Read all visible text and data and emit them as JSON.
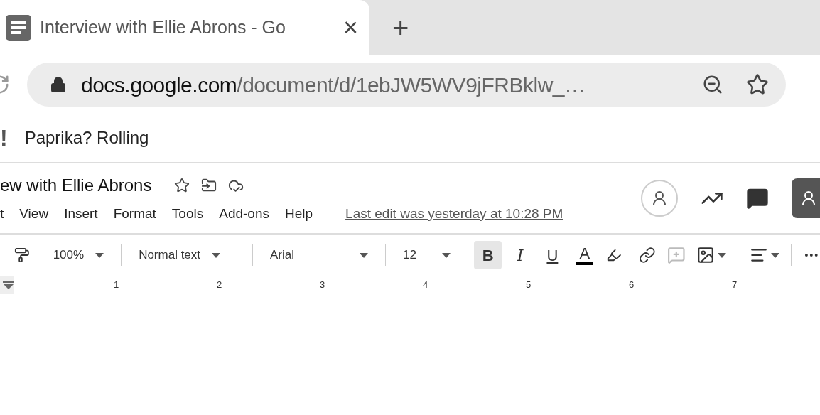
{
  "browser": {
    "tab": {
      "title": "Interview with Ellie Abrons - Go",
      "close": "×",
      "selected": true
    },
    "new_tab": "+",
    "address": {
      "host": "docs.google.com",
      "path": "/document/d/1ebJW5WV9jFRBklw_…"
    },
    "bookmarks": [
      {
        "icon": "!",
        "label": "Paprika? Rolling"
      }
    ]
  },
  "doc": {
    "title": "ew with Ellie Abrons",
    "menu": [
      {
        "label": "t"
      },
      {
        "label": "View"
      },
      {
        "label": "Insert"
      },
      {
        "label": "Format"
      },
      {
        "label": "Tools"
      },
      {
        "label": "Add-ons"
      },
      {
        "label": "Help"
      }
    ],
    "last_edit": "Last edit was yesterday at 10:28 PM"
  },
  "toolbar": {
    "zoom": "100%",
    "style": "Normal text",
    "font": "Arial",
    "size": "12",
    "buttons": [
      {
        "kind": "bold",
        "label": "B",
        "selected": true
      },
      {
        "kind": "italic",
        "label": "I",
        "selected": false
      },
      {
        "kind": "underline",
        "label": "U",
        "selected": false
      },
      {
        "kind": "color",
        "label": "A",
        "selected": false
      }
    ],
    "add_comment_disabled": true
  },
  "ruler": {
    "marks": [
      "1",
      "2",
      "3",
      "4",
      "5",
      "6",
      "7"
    ]
  }
}
